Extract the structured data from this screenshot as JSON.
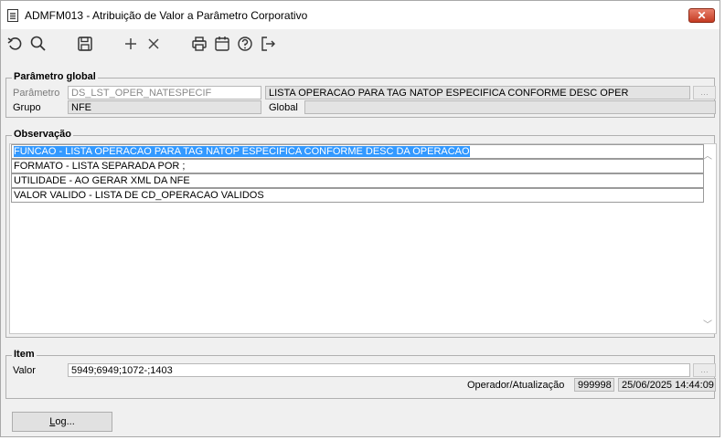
{
  "window": {
    "title": "ADMFM013 - Atribuição de Valor a Parâmetro Corporativo",
    "close_label": "✕"
  },
  "toolbar": {
    "icons": [
      "undo-icon",
      "search-icon",
      "save-icon",
      "add-icon",
      "delete-icon",
      "print-icon",
      "calendar-icon",
      "help-icon",
      "exit-icon"
    ]
  },
  "parametro_global": {
    "group_label": "Parâmetro global",
    "parametro_label": "Parâmetro",
    "parametro_value": "DS_LST_OPER_NATESPECIF",
    "descricao_value": "LISTA OPERACAO PARA TAG NATOP ESPECIFICA CONFORME DESC OPER",
    "grupo_label": "Grupo",
    "grupo_value": "NFE",
    "global_label": "Global",
    "global_value": ""
  },
  "observacao": {
    "group_label": "Observação",
    "lines": [
      "FUNCAO - LISTA OPERACAO PARA TAG NATOP ESPECIFICA CONFORME DESC DA OPERACAO",
      "FORMATO - LISTA SEPARADA POR ;",
      "UTILIDADE - AO GERAR XML DA NFE",
      "VALOR VALIDO - LISTA DE CD_OPERACAO VALIDOS"
    ]
  },
  "item": {
    "group_label": "Item",
    "valor_label": "Valor",
    "valor_value": "5949;6949;1072-;1403",
    "operador_label": "Operador/Atualização",
    "operador_value": "999998",
    "atualizacao_value": "25/06/2025 14:44:09"
  },
  "footer": {
    "log_button_first": "L",
    "log_button_rest": "og..."
  },
  "colors": {
    "selection": "#3399ff",
    "close_button": "#c43b22"
  }
}
